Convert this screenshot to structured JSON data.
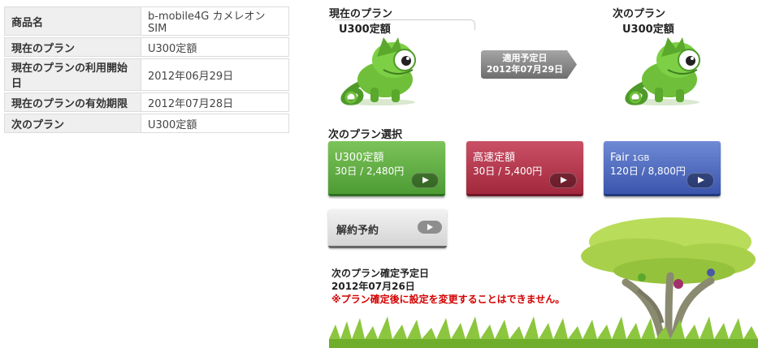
{
  "info_table": [
    {
      "label": "商品名",
      "value": "b-mobile4G カメレオンSIM"
    },
    {
      "label": "現在のプラン",
      "value": "U300定額"
    },
    {
      "label": "現在のプランの利用開始日",
      "value": "2012年06月29日"
    },
    {
      "label": "現在のプランの有効期限",
      "value": "2012年07月28日"
    },
    {
      "label": "次のプラン",
      "value": "U300定額"
    }
  ],
  "current_plan": {
    "heading": "現在のプラン",
    "name": "U300定額"
  },
  "next_plan": {
    "heading": "次のプラン",
    "name": "U300定額"
  },
  "apply": {
    "label": "適用予定日",
    "date": "2012年07月29日"
  },
  "plan_select": {
    "title": "次のプラン選択",
    "options": [
      {
        "name": "U300定額",
        "unit": "",
        "price": "30日 / 2,480円",
        "color": "#5aaa3f"
      },
      {
        "name": "高速定額",
        "unit": "",
        "price": "30日 / 5,400円",
        "color": "#b33a50"
      },
      {
        "name": "Fair ",
        "unit": "1GB",
        "price": "120日 / 8,800円",
        "color": "#4a66bf"
      }
    ]
  },
  "cancel": {
    "label": "解約予約"
  },
  "confirm": {
    "title": "次のプラン確定予定日",
    "date": "2012年07月26日",
    "note": "※プラン確定後に設定を変更することはできません。"
  },
  "icons": {
    "chameleon": "chameleon-mascot",
    "play": "play-icon",
    "tree": "acacia-tree-illustration"
  },
  "colors": {
    "mascot": "#6fbf3a",
    "arrow": "#888888",
    "warning": "#d40000"
  }
}
